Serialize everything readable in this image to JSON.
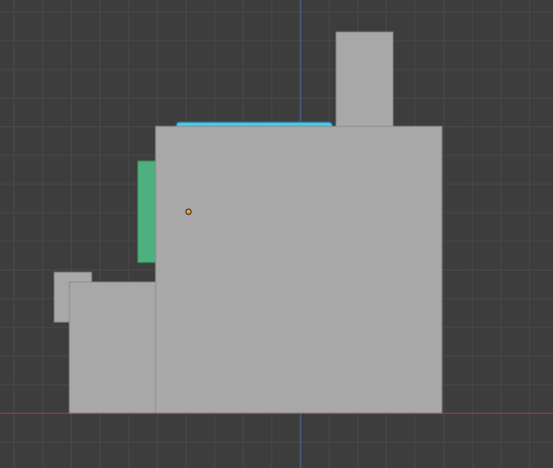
{
  "viewport": {
    "view": "orthographic-front",
    "background_color": "#3d3d3d",
    "grid_color": "#4a4a4a",
    "x_axis_color": "#a43d3d",
    "z_axis_color": "#3f6ea0"
  },
  "objects": [
    {
      "name": "main-cube",
      "color": "#a8a8a9",
      "selected": false
    },
    {
      "name": "top-tower",
      "color": "#a8a8a9",
      "selected": false
    },
    {
      "name": "left-block",
      "color": "#a8a8a9",
      "selected": false
    },
    {
      "name": "small-left-block",
      "color": "#a8a8a9",
      "selected": false
    },
    {
      "name": "green-panel",
      "color": "#4fb07f",
      "selected": false
    },
    {
      "name": "cyan-plate",
      "color": "#4fc7e0",
      "selected": true
    }
  ],
  "origin_point": {
    "color": "#f0a030",
    "outline": "#1a1a1a"
  }
}
